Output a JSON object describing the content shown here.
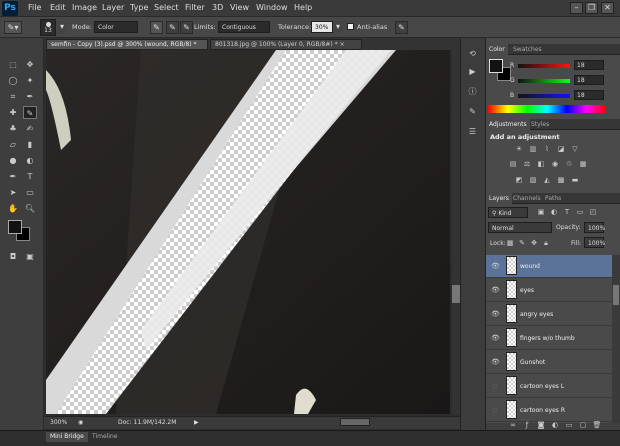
{
  "app": {
    "logo": "Ps"
  },
  "menu": [
    "File",
    "Edit",
    "Image",
    "Layer",
    "Type",
    "Select",
    "Filter",
    "3D",
    "View",
    "Window",
    "Help"
  ],
  "window_controls": {
    "minimize": "–",
    "restore": "❐",
    "close": "✕"
  },
  "options": {
    "brush_size": "13",
    "mode_label": "Mode:",
    "mode_value": "Color",
    "limits_label": "Limits:",
    "limits_value": "Contiguous",
    "tolerance_label": "Tolerance:",
    "tolerance_value": "30%",
    "antialias_label": "Anti-alias"
  },
  "tabs": [
    {
      "label": "semfin - Copy (3).psd @ 300% (wound, RGB/8) *",
      "close": "×"
    },
    {
      "label": "801318.jpg @ 100% (Layer 0, RGB/8#) *",
      "close": "×"
    }
  ],
  "status": {
    "zoom": "300%",
    "doc": "Doc: 11.9M/142.2M"
  },
  "bottom_tabs": [
    "Mini Bridge",
    "Timeline"
  ],
  "color_panel": {
    "tabs": [
      "Color",
      "Swatches"
    ],
    "r_label": "R",
    "r_value": "18",
    "g_label": "G",
    "g_value": "18",
    "b_label": "B",
    "b_value": "18"
  },
  "adjust_panel": {
    "tabs": [
      "Adjustments",
      "Styles"
    ],
    "title": "Add an adjustment"
  },
  "layers_panel": {
    "tabs": [
      "Layers",
      "Channels",
      "Paths"
    ],
    "kind": "Kind",
    "blend": "Normal",
    "opacity_label": "Opacity:",
    "opacity_value": "100%",
    "lock_label": "Lock:",
    "fill_label": "Fill:",
    "fill_value": "100%",
    "layers": [
      {
        "name": "wound",
        "visible": true,
        "selected": true
      },
      {
        "name": "eyes",
        "visible": true,
        "selected": false
      },
      {
        "name": "angry eyes",
        "visible": true,
        "selected": false
      },
      {
        "name": "fingers w/o thumb",
        "visible": true,
        "selected": false
      },
      {
        "name": "Gunshot",
        "visible": true,
        "selected": false
      },
      {
        "name": "cartoon eyes L",
        "visible": false,
        "selected": false
      },
      {
        "name": "cartoon eyes R",
        "visible": false,
        "selected": false
      }
    ]
  },
  "colors": {
    "accent": "#5b7398",
    "ps_blue": "#31a8ff",
    "foreground": "#121212",
    "background": "#000000"
  }
}
